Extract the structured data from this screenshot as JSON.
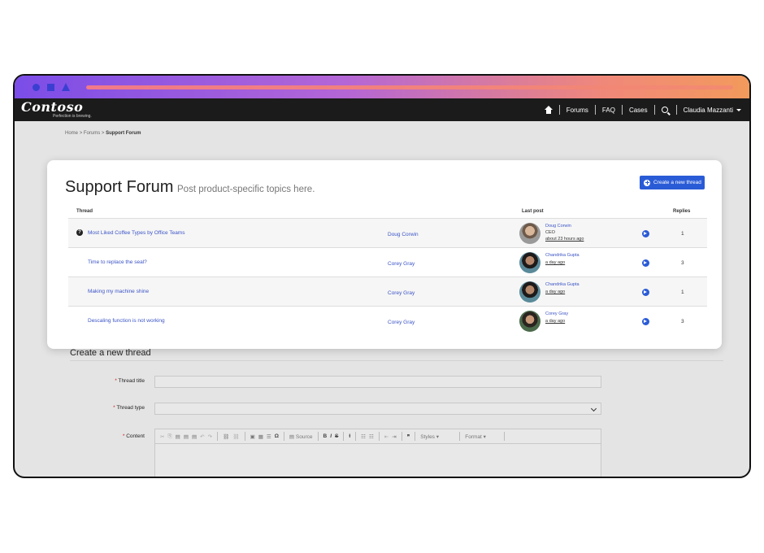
{
  "brand": {
    "logo": "Contoso",
    "tagline": "Perfection is brewing."
  },
  "nav": {
    "forums": "Forums",
    "faq": "FAQ",
    "cases": "Cases",
    "user": "Claudia Mazzanti"
  },
  "breadcrumb": {
    "home": "Home",
    "sep": ">",
    "forums": "Forums",
    "current": "Support Forum"
  },
  "forum": {
    "title": "Support Forum",
    "subtitle": "Post product-specific topics here.",
    "create_label": "Create a new thread",
    "columns": {
      "thread": "Thread",
      "last_post": "Last post",
      "replies": "Replies"
    },
    "rows": [
      {
        "thread": "Most Liked Coffee Types by Office Teams",
        "author": "Doug Corwin",
        "lp_name": "Doug Corwin",
        "lp_role": "CEO",
        "lp_time": "about 23 hours ago",
        "replies": "1"
      },
      {
        "thread": "Time to replace the seal?",
        "author": "Corey Gray",
        "lp_name": "Chandrika Gupta",
        "lp_role": "",
        "lp_time": "a day ago",
        "replies": "3"
      },
      {
        "thread": "Making my machine shine",
        "author": "Corey Gray",
        "lp_name": "Chandrika Gupta",
        "lp_role": "",
        "lp_time": "a day ago",
        "replies": "1"
      },
      {
        "thread": "Descaling function is not working",
        "author": "Corey Gray",
        "lp_name": "Corey Gray",
        "lp_role": "",
        "lp_time": "a day ago",
        "replies": "3"
      }
    ]
  },
  "form": {
    "title": "Create a new thread",
    "required_mark": "*",
    "thread_title_label": "Thread title",
    "thread_type_label": "Thread type",
    "content_label": "Content",
    "toolbar": {
      "source": "Source",
      "bold": "B",
      "italic": "I",
      "strike": "S",
      "styles": "Styles",
      "format": "Format"
    }
  },
  "colors": {
    "accent": "#2a5bd7",
    "link": "#3b54c6",
    "nav_bg": "#1b1b1b"
  }
}
